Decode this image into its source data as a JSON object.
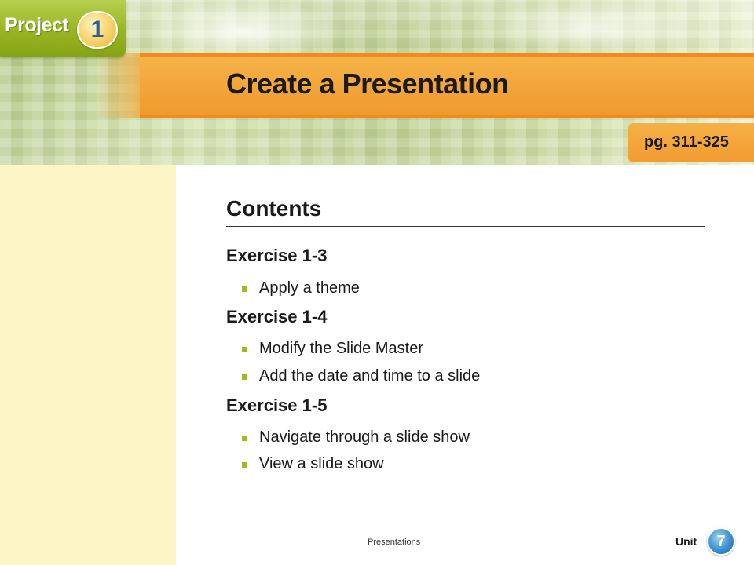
{
  "header": {
    "project_label": "Project",
    "project_number": "1",
    "title": "Create a Presentation",
    "page_ref": "pg. 311-325"
  },
  "contents": {
    "heading": "Contents",
    "sections": [
      {
        "title": "Exercise 1-3",
        "items": [
          "Apply a theme"
        ]
      },
      {
        "title": "Exercise 1-4",
        "items": [
          "Modify the Slide Master",
          "Add the date and time to a slide"
        ]
      },
      {
        "title": "Exercise 1-5",
        "items": [
          "Navigate through a slide show",
          "View a slide show"
        ]
      }
    ]
  },
  "footer": {
    "center_text": "Presentations",
    "unit_label": "Unit",
    "unit_number": "7"
  },
  "colors": {
    "title_bar": "#f3a63a",
    "title_bar_border": "#f28a1e",
    "project_tab": "#97b523",
    "sidebar": "#fdf5c5",
    "bullet": "#9bb92a",
    "unit_badge": "#3a8fcf"
  },
  "icons": {
    "bullet": "square-bullet-icon",
    "project_badge": "project-number-badge",
    "unit_badge": "unit-number-badge"
  }
}
